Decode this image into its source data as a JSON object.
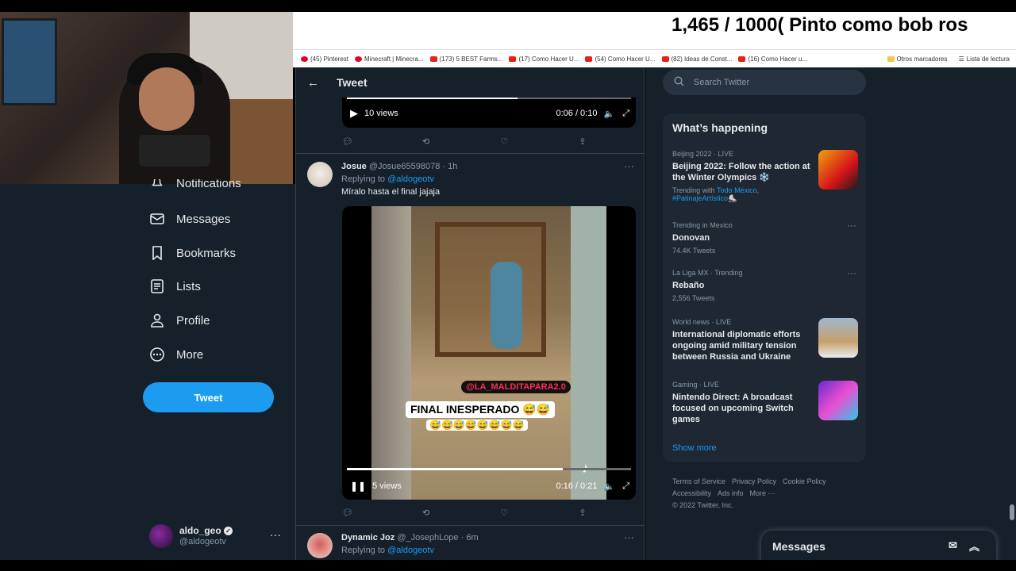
{
  "overlay": {
    "text": "1,465 / 1000( Pinto como bob ros"
  },
  "bookmarks": {
    "items": [
      "(45) Pinterest",
      "Minecraft | Minecra...",
      "(173) 5 BEST Farms...",
      "(17) Como Hacer U...",
      "(54) Como Hacer U...",
      "(82) Ideas de Const...",
      "(16) Como Hacer u..."
    ],
    "other": "Otros marcadores",
    "reading_list": "Lista de lectura"
  },
  "sidebar": {
    "nav": [
      "Notifications",
      "Messages",
      "Bookmarks",
      "Lists",
      "Profile",
      "More"
    ],
    "tweet_button": "Tweet",
    "account": {
      "name": "aldo_geo",
      "handle": "@aldogeotv"
    }
  },
  "main": {
    "title": "Tweet",
    "video1": {
      "views": "10 views",
      "time": "0:06 / 0:10",
      "progress": 0.6
    },
    "tweet1": {
      "name": "Josue",
      "handle": "@Josue65598078",
      "time": "· 1h",
      "replying_label": "Replying to",
      "replying_to": "@aldogeotv",
      "text": "Míralo hasta el final jajaja",
      "video": {
        "views": "5 views",
        "time": "0:16 / 0:21",
        "progress": 0.76,
        "tag": "@LA_MALDITAPARA2.0",
        "caption": "FINAL INESPERADO 😅😅",
        "emojis": "😅😅😅😅😅😅😅😅"
      }
    },
    "tweet2": {
      "name": "Dynamic Joz",
      "handle": "@_JosephLope",
      "time": "· 6m",
      "replying_label": "Replying to",
      "replying_to": "@aldogeotv"
    }
  },
  "right": {
    "search_placeholder": "Search Twitter",
    "happening_title": "What’s happening",
    "trends": [
      {
        "meta": "Beijing 2022 · LIVE",
        "name": "Beijing 2022: Follow the action at the Winter Olympics ❄️",
        "sub_prefix": "Trending with",
        "sub_link1": "Todo México",
        "sub_link2": "#PatinajeArtístico⛸️"
      },
      {
        "meta": "Trending in Mexico",
        "name": "Donovan",
        "sub": "74.4K Tweets"
      },
      {
        "meta": "La Liga MX · Trending",
        "name": "Rebaño",
        "sub": "2,556 Tweets"
      },
      {
        "meta": "World news · LIVE",
        "name": "International diplomatic efforts ongoing amid military tension between Russia and Ukraine"
      },
      {
        "meta": "Gaming · LIVE",
        "name": "Nintendo Direct: A broadcast focused on upcoming Switch games"
      }
    ],
    "show_more": "Show more",
    "footer": [
      "Terms of Service",
      "Privacy Policy",
      "Cookie Policy",
      "Accessibility",
      "Ads info",
      "More ···",
      "© 2022 Twitter, Inc."
    ],
    "messages_dock": "Messages"
  }
}
